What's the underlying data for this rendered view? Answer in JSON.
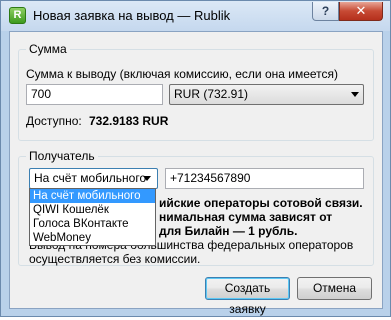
{
  "window": {
    "title": "Новая заявка на вывод — Rublik",
    "app_icon_glyph": "R",
    "help_label": "?",
    "close_label": "✕"
  },
  "amount_group": {
    "title": "Сумма",
    "amount_label": "Сумма к выводу (включая комиссию, если она имеется)",
    "amount_value": "700",
    "currency_selected": "RUR (732.91)",
    "available_label": "Доступно:",
    "available_value": "732.9183 RUR"
  },
  "recipient_group": {
    "title": "Получатель",
    "method_selected": "На счёт мобильного",
    "method_options": [
      "На счёт мобильного",
      "QIWI Кошелёк",
      "Голоса ВКонтакте",
      "WebMoney"
    ],
    "phone_value": "+71234567890",
    "info_line1": "ийские операторы сотовой связи.",
    "info_line2": "нимальная сумма зависят от",
    "info_line3": "для Билайн — 1 рубль.",
    "info_line4": "Вывод на номера большинства федеральных операторов",
    "info_line5": "осуществляется без комиссии."
  },
  "buttons": {
    "create": "Создать заявку",
    "cancel": "Отмена"
  },
  "colors": {
    "selection": "#3399ff",
    "close_button": "#c74a34"
  }
}
